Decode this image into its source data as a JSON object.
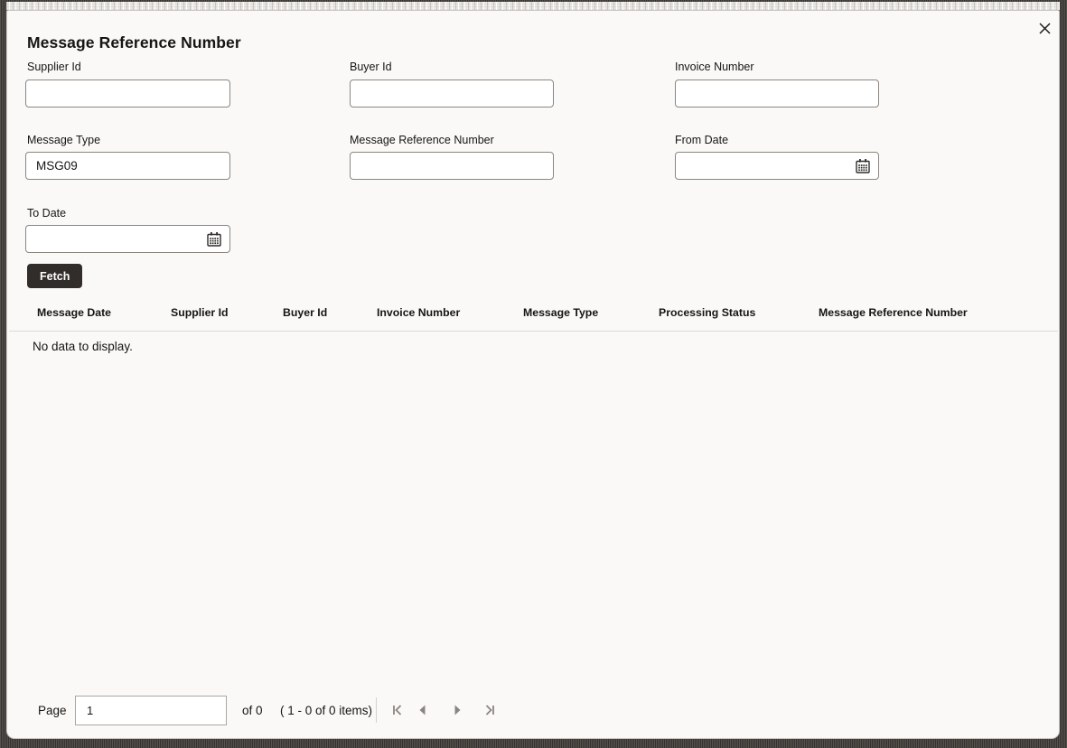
{
  "modal": {
    "title": "Message Reference Number"
  },
  "form": {
    "fields": [
      {
        "label": "Supplier Id",
        "value": "",
        "type": "text"
      },
      {
        "label": "Buyer Id",
        "value": "",
        "type": "text"
      },
      {
        "label": "Invoice Number",
        "value": "",
        "type": "text"
      },
      {
        "label": "Message Type",
        "value": "MSG09",
        "type": "text"
      },
      {
        "label": "Message Reference Number",
        "value": "",
        "type": "text"
      },
      {
        "label": "From Date",
        "value": "",
        "type": "date"
      },
      {
        "label": "To Date",
        "value": "",
        "type": "date"
      }
    ],
    "fetch_button_label": "Fetch"
  },
  "table": {
    "columns": [
      "Message Date",
      "Supplier Id",
      "Buyer Id",
      "Invoice Number",
      "Message Type",
      "Processing Status",
      "Message Reference Number"
    ],
    "rows": [],
    "empty_message": "No data to display."
  },
  "pagination": {
    "page_label": "Page",
    "page_value": "1",
    "of_label": "of 0",
    "items_label": "( 1 - 0 of 0 items)"
  },
  "icons": {
    "close": "close-icon",
    "calendar": "calendar-icon",
    "first": "first-page-icon",
    "previous": "previous-page-icon",
    "next": "next-page-icon",
    "last": "last-page-icon"
  },
  "colors": {
    "modal_bg": "#fbf9f8",
    "text": "#161513",
    "input_border": "#8b8580",
    "button_bg": "#312d2a",
    "button_text": "#ffffff",
    "divider": "#dbd8d4",
    "pagination_icon": "#8b8580"
  }
}
